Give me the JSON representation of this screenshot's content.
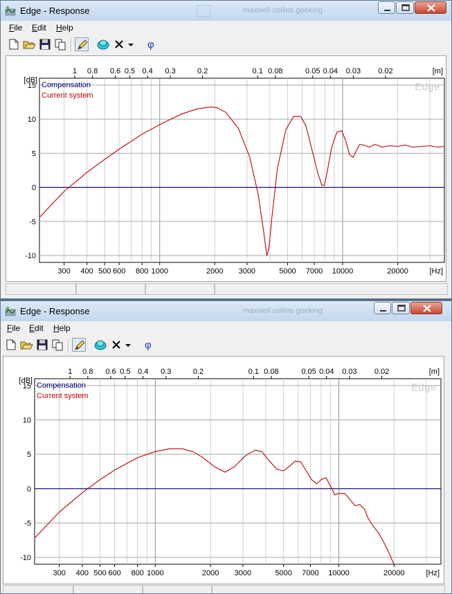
{
  "windows": [
    {
      "title": "Edge - Response",
      "ghost_title": "maxwell collins geeking",
      "menu": [
        "File",
        "Edit",
        "Help"
      ],
      "chart_data": {
        "type": "line",
        "title": "",
        "xlabel": "[Hz]",
        "ylabel": "[dB]",
        "top_axis_label": "[m]",
        "watermark": "Edge",
        "x_scale": "log",
        "xlim": [
          220,
          36000
        ],
        "ylim": [
          -11,
          16
        ],
        "x_ticks": [
          300,
          400,
          500,
          600,
          800,
          1000,
          2000,
          3000,
          5000,
          7000,
          10000,
          20000
        ],
        "x_tick_labels": [
          "300",
          "400",
          "500",
          "600",
          "800",
          "1000",
          "2000",
          "3000",
          "5000",
          "7000",
          "10000",
          "20000"
        ],
        "y_ticks": [
          15,
          10,
          5,
          0,
          -5,
          -10
        ],
        "y_tick_labels": [
          "15",
          "10",
          "5",
          "0",
          "-5",
          "-10"
        ],
        "top_ticks": [
          1,
          0.8,
          0.6,
          0.5,
          0.4,
          0.3,
          0.2,
          0.1,
          0.08,
          0.05,
          0.04,
          0.03,
          0.02
        ],
        "top_tick_labels": [
          "1",
          "0.8",
          "0.6",
          "0.5",
          "0.4",
          "0.3",
          "0.2",
          "0.1",
          "0.08",
          "0.05",
          "0.04",
          "0.03",
          "0.02"
        ],
        "grid": true,
        "legend_position": "top-left",
        "series": [
          {
            "name": "Compensation",
            "color": "#000080",
            "x": [
              220,
              36000
            ],
            "y": [
              0,
              0
            ]
          },
          {
            "name": "Current system",
            "color": "#c00000",
            "x": [
              220,
              300,
              400,
              500,
              600,
              800,
              1000,
              1300,
              1600,
              1900,
              2050,
              2300,
              2700,
              3100,
              3450,
              3700,
              3850,
              3950,
              4100,
              4400,
              4900,
              5400,
              5900,
              6300,
              6800,
              7300,
              7700,
              7950,
              8200,
              8700,
              9300,
              9900,
              10400,
              10900,
              11400,
              11900,
              12400,
              13000,
              14000,
              15000,
              16500,
              18000,
              20000,
              22000,
              24000,
              27000,
              30000,
              33000,
              36000
            ],
            "y": [
              -4.4,
              -0.6,
              2.2,
              4.1,
              5.6,
              7.8,
              9.2,
              10.7,
              11.5,
              11.8,
              11.7,
              11.0,
              8.6,
              4.5,
              -1.0,
              -6.5,
              -10.0,
              -9.0,
              -4.5,
              2.8,
              8.5,
              10.4,
              10.4,
              9.0,
              5.5,
              2.2,
              0.3,
              0.3,
              2.0,
              5.8,
              8.1,
              8.3,
              6.8,
              4.8,
              4.4,
              5.4,
              6.3,
              6.2,
              5.9,
              6.3,
              5.9,
              6.1,
              6.0,
              6.2,
              5.9,
              6.0,
              6.1,
              5.9,
              6.0
            ]
          }
        ]
      }
    },
    {
      "title": "Edge - Response",
      "ghost_title": "maxwell collins geeking",
      "menu": [
        "File",
        "Edit",
        "Help"
      ],
      "chart_data": {
        "type": "line",
        "title": "",
        "xlabel": "[Hz]",
        "ylabel": "[dB]",
        "top_axis_label": "[m]",
        "watermark": "Edge",
        "x_scale": "log",
        "xlim": [
          220,
          36000
        ],
        "ylim": [
          -11,
          16
        ],
        "x_ticks": [
          300,
          400,
          500,
          600,
          800,
          1000,
          2000,
          3000,
          5000,
          7000,
          10000,
          20000
        ],
        "x_tick_labels": [
          "300",
          "400",
          "500",
          "600",
          "800",
          "1000",
          "2000",
          "3000",
          "5000",
          "7000",
          "10000",
          "20000"
        ],
        "y_ticks": [
          15,
          10,
          5,
          0,
          -5,
          -10
        ],
        "y_tick_labels": [
          "15",
          "10",
          "5",
          "0",
          "-5",
          "-10"
        ],
        "top_ticks": [
          1,
          0.8,
          0.6,
          0.5,
          0.4,
          0.3,
          0.2,
          0.1,
          0.08,
          0.05,
          0.04,
          0.03,
          0.02
        ],
        "top_tick_labels": [
          "1",
          "0.8",
          "0.6",
          "0.5",
          "0.4",
          "0.3",
          "0.2",
          "0.1",
          "0.08",
          "0.05",
          "0.04",
          "0.03",
          "0.02"
        ],
        "grid": true,
        "legend_position": "top-left",
        "series": [
          {
            "name": "Compensation",
            "color": "#000080",
            "x": [
              220,
              36000
            ],
            "y": [
              0,
              0
            ]
          },
          {
            "name": "Current system",
            "color": "#c00000",
            "x": [
              220,
              300,
              400,
              500,
              600,
              800,
              1000,
              1200,
              1400,
              1600,
              1800,
              2100,
              2400,
              2700,
              3100,
              3500,
              3800,
              4100,
              4600,
              5000,
              5400,
              5800,
              6200,
              6600,
              7100,
              7600,
              8000,
              8500,
              9000,
              9500,
              10000,
              10800,
              11500,
              12300,
              13000,
              13800,
              14500,
              15500,
              16500,
              17500,
              18500,
              19500,
              20000
            ],
            "y": [
              -7.2,
              -3.4,
              -0.6,
              1.3,
              2.7,
              4.5,
              5.4,
              5.8,
              5.8,
              5.4,
              4.6,
              3.2,
              2.4,
              3.2,
              4.8,
              5.6,
              5.4,
              4.3,
              2.8,
              2.6,
              3.3,
              4.0,
              3.9,
              2.7,
              1.3,
              0.7,
              1.3,
              1.6,
              0.4,
              -0.9,
              -0.7,
              -0.7,
              -1.6,
              -2.5,
              -2.3,
              -3.0,
              -4.4,
              -5.6,
              -6.5,
              -7.7,
              -9.0,
              -10.4,
              -11.0
            ]
          }
        ]
      }
    }
  ]
}
